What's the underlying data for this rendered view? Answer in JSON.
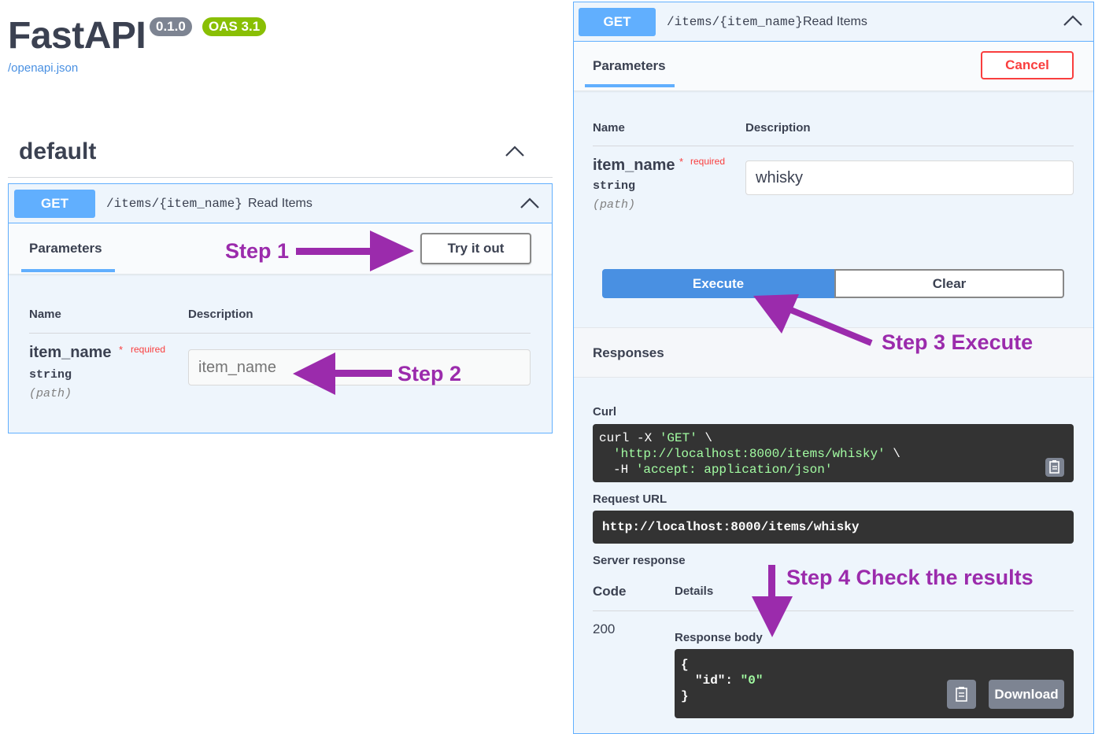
{
  "header": {
    "title": "FastAPI",
    "version_badge": "0.1.0",
    "oas_badge": "OAS 3.1",
    "spec_link": "/openapi.json"
  },
  "section": {
    "title": "default"
  },
  "operation": {
    "method": "GET",
    "path": "/items/{item_name}",
    "summary": "Read Items",
    "tab_label": "Parameters",
    "try_button": "Try it out",
    "cancel_button": "Cancel",
    "columns": {
      "name": "Name",
      "description": "Description"
    },
    "param": {
      "name": "item_name",
      "star": "*",
      "required": "required",
      "type": "string",
      "in": "(path)",
      "placeholder": "item_name",
      "value": "whisky"
    },
    "execute_button": "Execute",
    "clear_button": "Clear",
    "responses_label": "Responses"
  },
  "curl": {
    "label": "Curl",
    "line1_cmd": "curl -X ",
    "line1_str": "'GET'",
    "line1_tail": " \\",
    "line2_str": "'http://localhost:8000/items/whisky'",
    "line2_tail": " \\",
    "line3_cmd": "-H ",
    "line3_str": "'accept: application/json'"
  },
  "request_url": {
    "label": "Request URL",
    "value": "http://localhost:8000/items/whisky"
  },
  "server_response": {
    "label": "Server response",
    "code_header": "Code",
    "details_header": "Details",
    "code": "200",
    "body_label": "Response body",
    "body_open": "{",
    "body_key": "\"id\"",
    "body_colon": ": ",
    "body_value": "\"0\"",
    "body_close": "}",
    "download_button": "Download"
  },
  "annotations": {
    "step1": "Step 1",
    "step2": "Step 2",
    "step3": "Step 3 Execute",
    "step4": "Step 4 Check the results"
  },
  "colors": {
    "get_blue": "#61affe",
    "annotation_purple": "#9b2bac",
    "required_red": "#f93e3e",
    "oas_green": "#89bf04"
  },
  "icons": [
    "chevron-up-icon",
    "arrow-right-icon",
    "arrow-left-icon",
    "arrow-up-left-icon",
    "arrow-down-icon",
    "copy-icon"
  ]
}
